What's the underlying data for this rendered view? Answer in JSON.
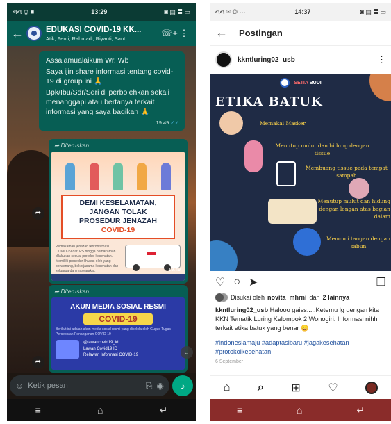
{
  "whatsapp": {
    "status": {
      "left": "નન ⚙ ■",
      "time": "13:29",
      "right": "◙ ▤ ≣ ▭"
    },
    "header": {
      "title": "EDUKASI COVID-19 KK...",
      "members": "Atik, Fenti, Rahmadi, Riyanti, Sant...",
      "back_icon": "←",
      "call_icon": "☏+",
      "menu_icon": "⋮"
    },
    "message": {
      "lines": [
        "Assalamualaikum Wr. Wb",
        "Saya ijin share informasi tentang covid-19 di group ini 🙏",
        "Bpk/Ibu/Sdr/Sdri di perbolehkan sekali  menanggapi atau bertanya terkait informasi yang saya bagikan 🙏"
      ],
      "time": "19.49",
      "ticks": "✓✓"
    },
    "forward1": {
      "label": "➦ Diteruskan",
      "banner": [
        "DEMI KESELAMATAN,",
        "JANGAN TOLAK",
        "PROSEDUR JENAZAH",
        "COVID-19"
      ],
      "body": "Pemakaman jenazah terkonfirmasi COVID-19 dari RS hingga pemakaman dilakukan sesuai protokol kesehatan. Memiliki prosedur khusus oleh yang berwenang, bekerjasama kesehatan dan keluarga dan masyarakat.",
      "time": "19.49"
    },
    "forward2": {
      "label": "➦ Diteruskan",
      "title": "AKUN MEDIA SOSIAL RESMI",
      "tag": "COVID-19",
      "desc": "Berikut ini adalah akun media sosial resmi yang dikelola oleh Gugus Tugas Percepatan Penanganan COVID-19",
      "accounts": [
        "@lawancovid19_id",
        "Lawan Covid19 ID",
        "Relawan Informasi COVID-19"
      ]
    },
    "input": {
      "placeholder": "Ketik pesan",
      "emoji_icon": "☺",
      "attach_icon": "⎘",
      "camera_icon": "◉",
      "mic_icon": "♪"
    },
    "share_icon": "➦",
    "scroll_icon": "⌄",
    "nav": {
      "menu": "≡",
      "home": "⌂",
      "back": "↵"
    }
  },
  "instagram": {
    "status": {
      "left": "નન ✉ ◎ ···",
      "time": "14:37",
      "right": "◙ ▤ ≣ ▭"
    },
    "header": {
      "back_icon": "←",
      "title": "Postingan"
    },
    "user": {
      "username": "kkntluring02_usb",
      "more_icon": "⋮"
    },
    "post": {
      "brand_a": "SETIA",
      "brand_b": "BUDI",
      "title": "ETIKA BATUK",
      "items": [
        "Memakai Masker",
        "Menutup mulut dan hidung dengan tissue",
        "Membuang tissue pada tempat sampah",
        "Menutup mulut dan hidung dengan lengan atas bagian dalam",
        "Mencuci tangan dengan sabun"
      ]
    },
    "actions": {
      "like_icon": "♡",
      "comment_icon": "○",
      "share_icon": "➤",
      "save_icon": "❐"
    },
    "likes": {
      "prefix": "Disukai oleh",
      "user": "novita_mhrni",
      "mid": "dan",
      "others": "2 lainnya"
    },
    "caption": {
      "user": "kkntluring02_usb",
      "text": "Halooo gaiss.....Ketemu lg dengan kita KKN Tematik Luring Kelompok 2 Wonogiri. Informasi nihh terkait etika batuk yang benar 😀"
    },
    "hashtags": "#indonesiamaju #adaptasibaru #jagakesehatan #protokolkesehatan",
    "date": "6 September",
    "bottom": {
      "home_icon": "⌂",
      "search_icon": "⌕",
      "add_icon": "⊞",
      "heart_icon": "♡"
    },
    "nav": {
      "menu": "≡",
      "home": "⌂",
      "back": "↵"
    }
  }
}
